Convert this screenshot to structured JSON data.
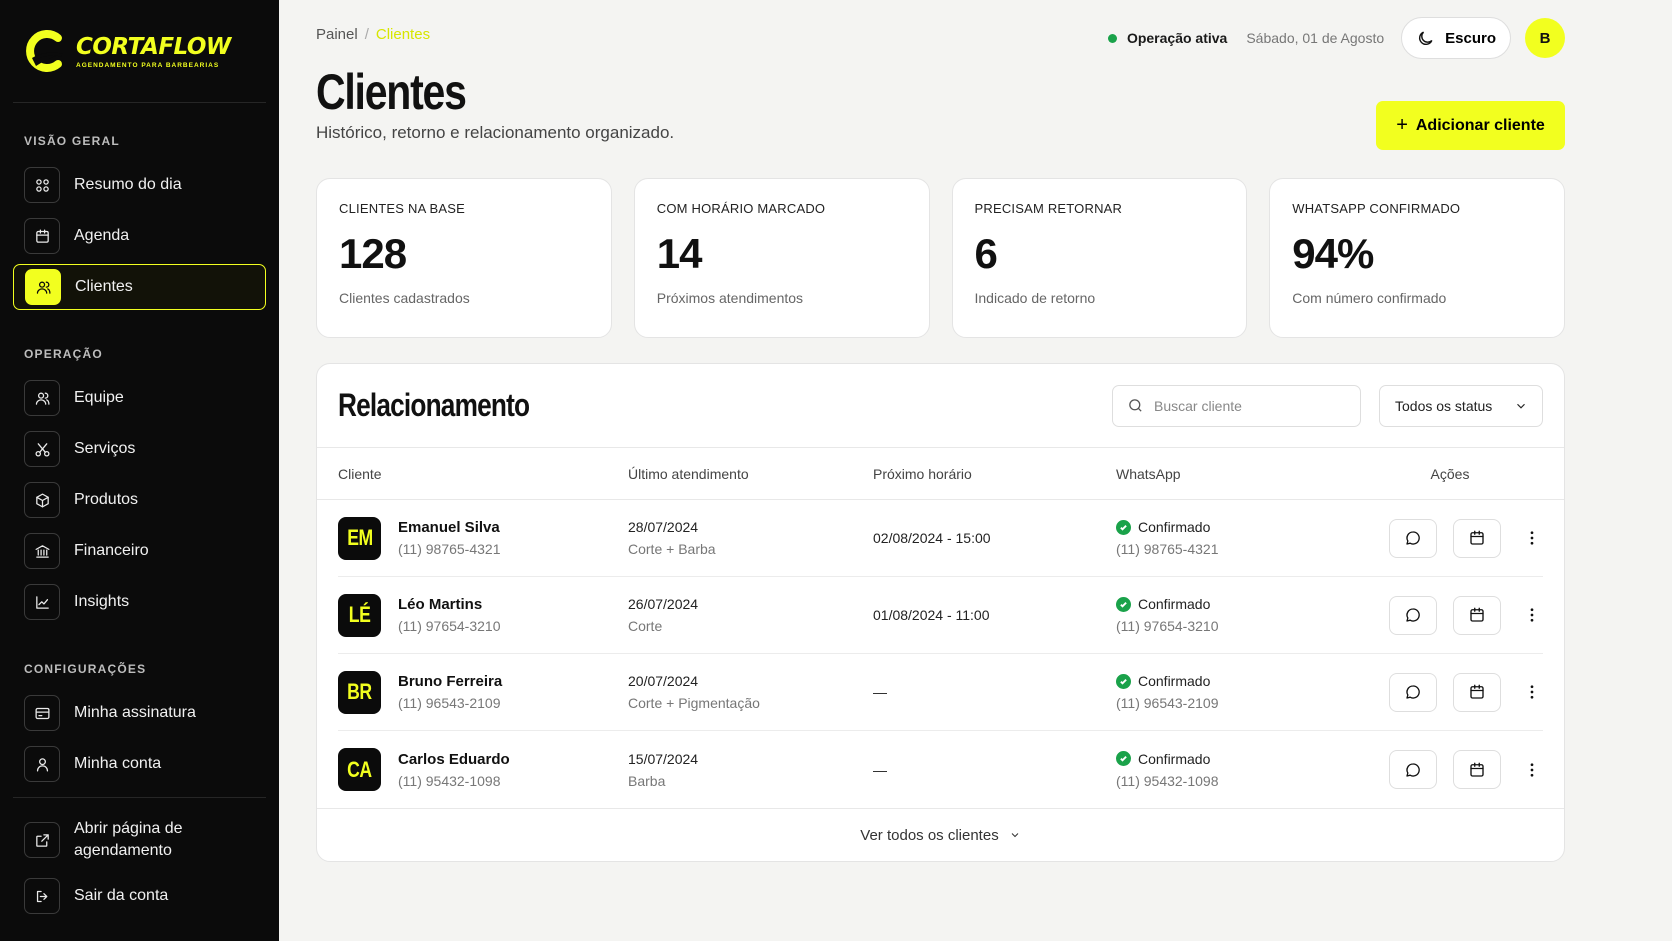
{
  "brand": {
    "name": "CORTAFLOW",
    "tagline": "AGENDAMENTO PARA BARBEARIAS",
    "accent": "#f2ff1f"
  },
  "sidebar": {
    "sections": [
      {
        "title": "VISÃO GERAL",
        "items": [
          {
            "label": "Resumo do dia",
            "icon": "grid-icon"
          },
          {
            "label": "Agenda",
            "icon": "calendar-icon"
          },
          {
            "label": "Clientes",
            "icon": "users-icon",
            "active": true
          }
        ]
      },
      {
        "title": "OPERAÇÃO",
        "items": [
          {
            "label": "Equipe",
            "icon": "users-icon"
          },
          {
            "label": "Serviços",
            "icon": "scissors-icon"
          },
          {
            "label": "Produtos",
            "icon": "box-icon"
          },
          {
            "label": "Financeiro",
            "icon": "bank-icon"
          },
          {
            "label": "Insights",
            "icon": "chart-icon"
          }
        ]
      },
      {
        "title": "CONFIGURAÇÕES",
        "items": [
          {
            "label": "Minha assinatura",
            "icon": "card-icon"
          },
          {
            "label": "Minha conta",
            "icon": "user-icon"
          }
        ]
      }
    ],
    "bottom": [
      {
        "label": "Abrir página de agendamento",
        "icon": "external-link-icon"
      },
      {
        "label": "Sair da conta",
        "icon": "logout-icon"
      }
    ]
  },
  "breadcrumb": {
    "root": "Painel",
    "separator": "/",
    "current": "Clientes"
  },
  "header": {
    "status": "Operação ativa",
    "status_color": "#1aa24a",
    "date": "Sábado, 01 de Agosto",
    "theme_label": "Escuro",
    "avatar_initial": "B"
  },
  "page": {
    "title": "Clientes",
    "subtitle": "Histórico, retorno e relacionamento organizado.",
    "add_button": "Adicionar cliente",
    "add_button_icon": "+"
  },
  "stats": [
    {
      "label": "CLIENTES NA BASE",
      "value": "128",
      "desc": "Clientes cadastrados"
    },
    {
      "label": "COM HORÁRIO MARCADO",
      "value": "14",
      "desc": "Próximos atendimentos"
    },
    {
      "label": "PRECISAM RETORNAR",
      "value": "6",
      "desc": "Indicado de retorno"
    },
    {
      "label": "WHATSAPP CONFIRMADO",
      "value": "94%",
      "desc": "Com número confirmado"
    }
  ],
  "relationship": {
    "title": "Relacionamento",
    "search_placeholder": "Buscar cliente",
    "filter_value": "Todos os status",
    "columns": [
      "Cliente",
      "Último atendimento",
      "Próximo horário",
      "WhatsApp",
      "Ações"
    ],
    "rows": [
      {
        "initials": "EM",
        "name": "Emanuel Silva",
        "phone": "(11) 98765-4321",
        "last_date": "28/07/2024",
        "last_service": "Corte + Barba",
        "next": "02/08/2024 - 15:00",
        "wa_status": "Confirmado",
        "wa_phone": "(11) 98765-4321"
      },
      {
        "initials": "LÉ",
        "name": "Léo Martins",
        "phone": "(11) 97654-3210",
        "last_date": "26/07/2024",
        "last_service": "Corte",
        "next": "01/08/2024 - 11:00",
        "wa_status": "Confirmado",
        "wa_phone": "(11) 97654-3210"
      },
      {
        "initials": "BR",
        "name": "Bruno Ferreira",
        "phone": "(11) 96543-2109",
        "last_date": "20/07/2024",
        "last_service": "Corte + Pigmentação",
        "next": "—",
        "wa_status": "Confirmado",
        "wa_phone": "(11) 96543-2109"
      },
      {
        "initials": "CA",
        "name": "Carlos Eduardo",
        "phone": "(11) 95432-1098",
        "last_date": "15/07/2024",
        "last_service": "Barba",
        "next": "—",
        "wa_status": "Confirmado",
        "wa_phone": "(11) 95432-1098"
      }
    ],
    "footer_link": "Ver todos os clientes"
  }
}
